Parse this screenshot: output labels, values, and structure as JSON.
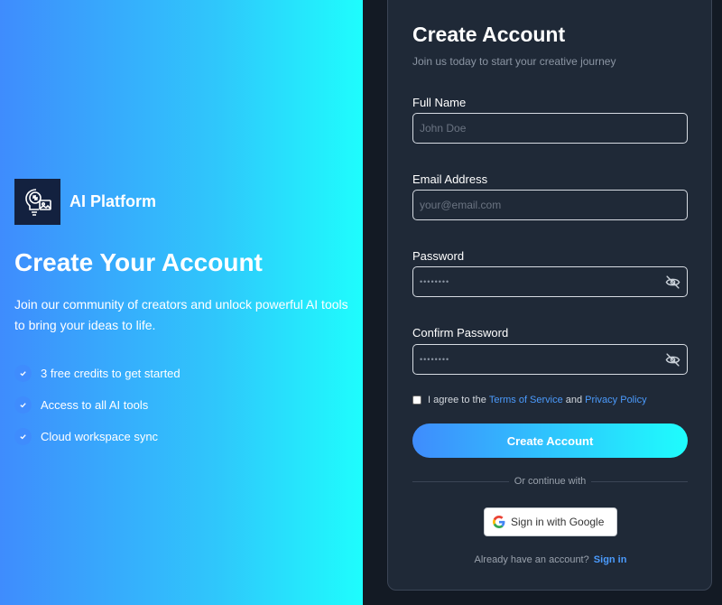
{
  "brand": {
    "name": "AI Platform",
    "logo_icon": "brain-bulb-icon"
  },
  "hero": {
    "title": "Create Your Account",
    "description": "Join our community of creators and unlock powerful AI tools to bring your ideas to life.",
    "features": [
      {
        "label": "3 free credits to get started",
        "icon": "check-icon"
      },
      {
        "label": "Access to all AI tools",
        "icon": "check-icon"
      },
      {
        "label": "Cloud workspace sync",
        "icon": "check-icon"
      }
    ]
  },
  "form": {
    "title": "Create Account",
    "subtitle": "Join us today to start your creative journey",
    "fields": {
      "full_name": {
        "label": "Full Name",
        "placeholder": "John Doe"
      },
      "email": {
        "label": "Email Address",
        "placeholder": "your@email.com"
      },
      "password": {
        "label": "Password",
        "masked": "••••••••"
      },
      "confirm_password": {
        "label": "Confirm Password",
        "masked": "••••••••"
      }
    },
    "agree": {
      "prefix": "I agree to the",
      "terms": "Terms of Service",
      "and": "and",
      "privacy": "Privacy Policy",
      "checked": false
    },
    "submit_label": "Create Account",
    "divider_text": "Or continue with",
    "google_label": "Sign in with Google",
    "signin_prompt": "Already have an account?",
    "signin_link": "Sign in"
  },
  "colors": {
    "gradient_start": "#3f8cfd",
    "gradient_end": "#1efdfd",
    "card_bg": "#1f2937",
    "page_bg": "#131a24",
    "link": "#4b9bfd"
  }
}
